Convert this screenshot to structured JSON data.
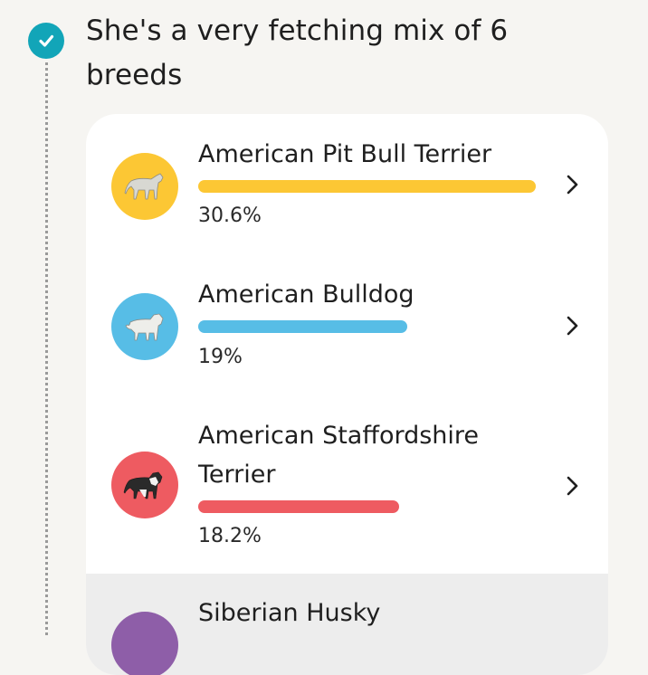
{
  "section": {
    "title": "She's a very fetching mix of 6 breeds"
  },
  "colors": {
    "accent": "#12a5b8",
    "pit_bull": "#fcc734",
    "bulldog": "#57bde6",
    "staffordshire": "#ee5b61",
    "husky": "#8e5ea8"
  },
  "breeds": [
    {
      "name": "American Pit Bull Terrier",
      "percent_label": "30.6%",
      "percent": 30.6,
      "bar_fraction": 1.0,
      "icon": "dog-pit-bull-icon",
      "color": "#fcc734"
    },
    {
      "name": "American Bulldog",
      "percent_label": "19%",
      "percent": 19,
      "bar_fraction": 0.62,
      "icon": "dog-bulldog-icon",
      "color": "#57bde6"
    },
    {
      "name": "American Staffordshire Terrier",
      "percent_label": "18.2%",
      "percent": 18.2,
      "bar_fraction": 0.595,
      "icon": "dog-staffordshire-icon",
      "color": "#ee5b61"
    },
    {
      "name": "Siberian Husky",
      "icon": "dog-husky-icon",
      "color": "#8e5ea8"
    }
  ]
}
